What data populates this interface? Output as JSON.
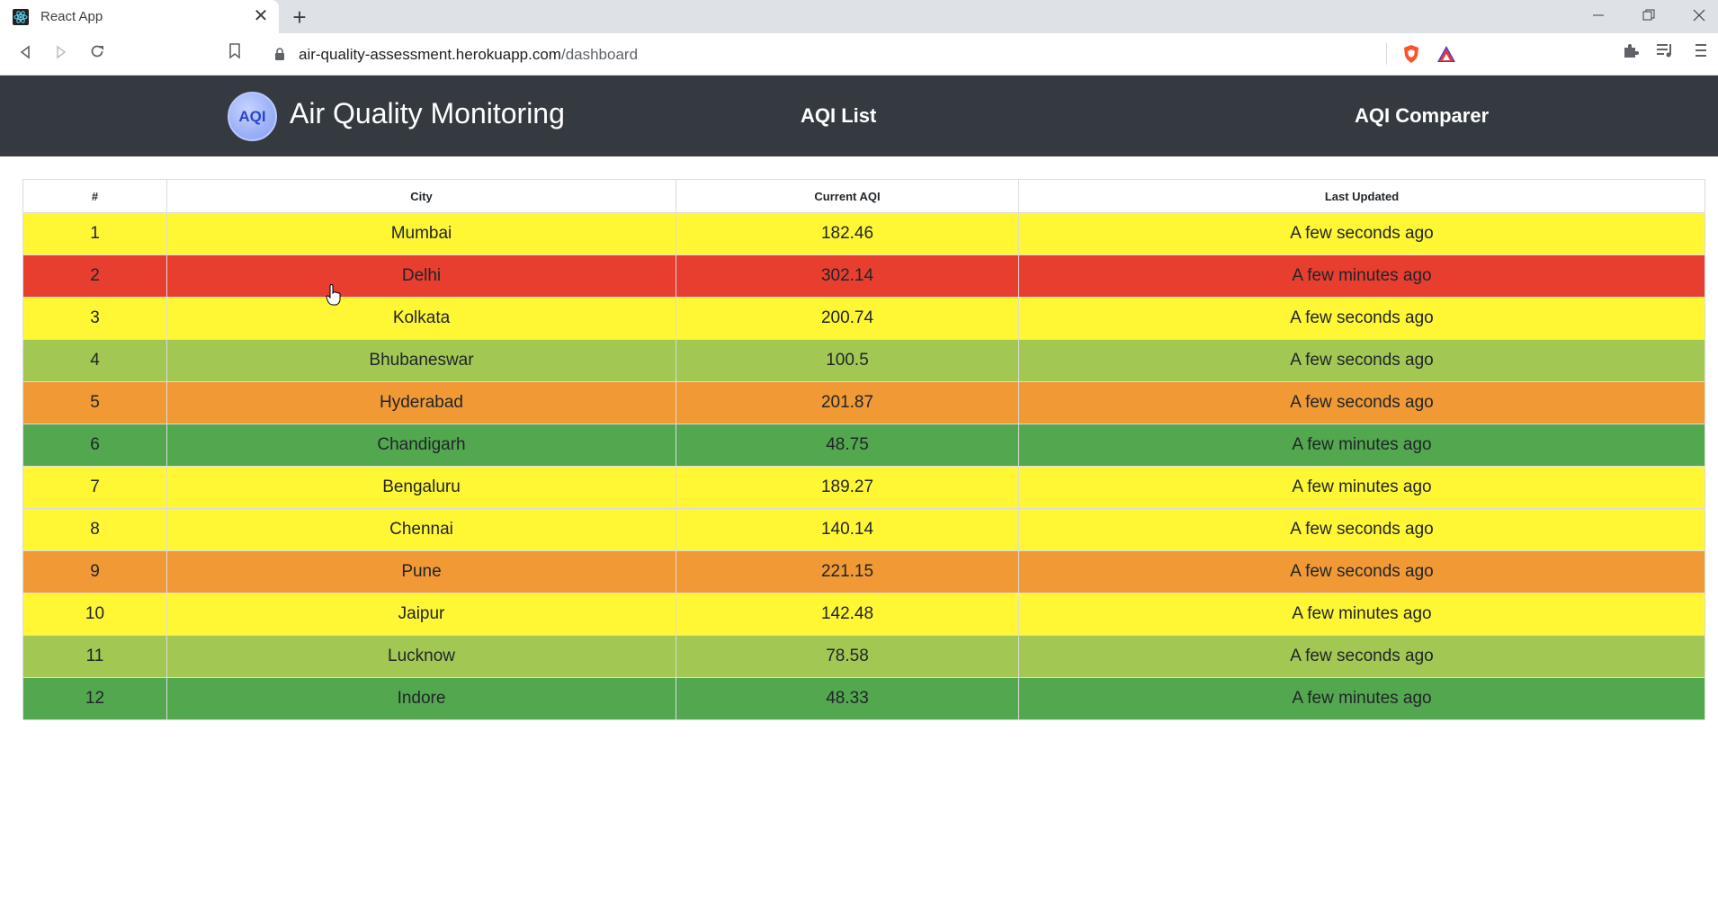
{
  "browser": {
    "tab_title": "React App",
    "tab_close": "✕",
    "new_tab": "+",
    "url_host": "air-quality-assessment.herokuapp.com",
    "url_path": "/dashboard"
  },
  "navbar": {
    "logo_text": "AQI",
    "brand": "Air Quality Monitoring",
    "links": [
      "AQI List",
      "AQI Comparer"
    ]
  },
  "table": {
    "headers": [
      "#",
      "City",
      "Current AQI",
      "Last Updated"
    ],
    "rows": [
      {
        "index": "1",
        "city": "Mumbai",
        "aqi": "182.46",
        "updated": "A few seconds ago",
        "color": "#fff734"
      },
      {
        "index": "2",
        "city": "Delhi",
        "aqi": "302.14",
        "updated": "A few minutes ago",
        "color": "#e83e30"
      },
      {
        "index": "3",
        "city": "Kolkata",
        "aqi": "200.74",
        "updated": "A few seconds ago",
        "color": "#fff734"
      },
      {
        "index": "4",
        "city": "Bhubaneswar",
        "aqi": "100.5",
        "updated": "A few seconds ago",
        "color": "#a2c853"
      },
      {
        "index": "5",
        "city": "Hyderabad",
        "aqi": "201.87",
        "updated": "A few seconds ago",
        "color": "#f09935"
      },
      {
        "index": "6",
        "city": "Chandigarh",
        "aqi": "48.75",
        "updated": "A few minutes ago",
        "color": "#53a74f"
      },
      {
        "index": "7",
        "city": "Bengaluru",
        "aqi": "189.27",
        "updated": "A few minutes ago",
        "color": "#fff734"
      },
      {
        "index": "8",
        "city": "Chennai",
        "aqi": "140.14",
        "updated": "A few seconds ago",
        "color": "#fff734"
      },
      {
        "index": "9",
        "city": "Pune",
        "aqi": "221.15",
        "updated": "A few seconds ago",
        "color": "#f09935"
      },
      {
        "index": "10",
        "city": "Jaipur",
        "aqi": "142.48",
        "updated": "A few minutes ago",
        "color": "#fff734"
      },
      {
        "index": "11",
        "city": "Lucknow",
        "aqi": "78.58",
        "updated": "A few seconds ago",
        "color": "#a2c853"
      },
      {
        "index": "12",
        "city": "Indore",
        "aqi": "48.33",
        "updated": "A few minutes ago",
        "color": "#53a74f"
      }
    ]
  }
}
